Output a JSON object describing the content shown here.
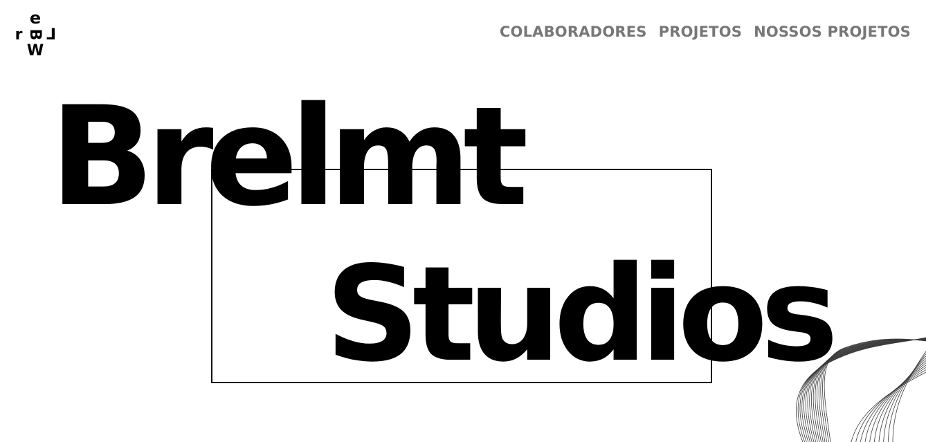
{
  "logo": {
    "alt": "ebrmw logo",
    "glyphs": {
      "top": "e",
      "left": "r",
      "center": "B",
      "right": "L",
      "bottom": "W"
    }
  },
  "nav": {
    "items": [
      {
        "label": "COLABORADORES"
      },
      {
        "label": "PROJETOS"
      },
      {
        "label": "NOSSOS PROJETOS"
      }
    ]
  },
  "hero": {
    "line1": "Brelmt",
    "line2": "Studios"
  },
  "colors": {
    "background": "#ffffff",
    "text": "#000000",
    "nav": "#777777",
    "frame": "#111111"
  }
}
